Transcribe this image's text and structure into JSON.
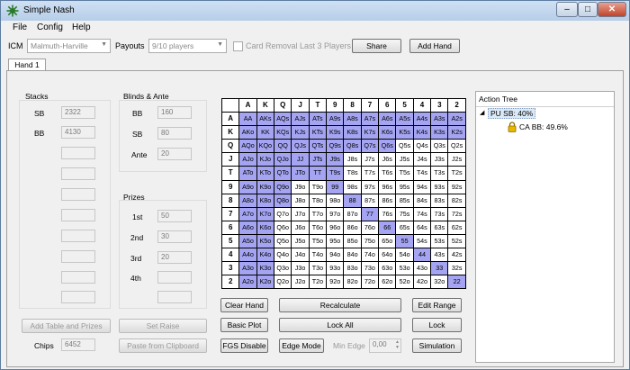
{
  "window": {
    "title": "Simple Nash"
  },
  "menu": [
    "File",
    "Config",
    "Help"
  ],
  "toolbar": {
    "icm_label": "ICM",
    "icm_value": "Malmuth-Harville",
    "payouts_label": "Payouts",
    "payouts_value": "9/10 players",
    "card_removal_label": "Card Removal Last 3 Players",
    "share_label": "Share",
    "add_hand_label": "Add Hand"
  },
  "tab": {
    "label": "Hand 1"
  },
  "stacks": {
    "title": "Stacks",
    "sb_label": "SB",
    "sb_value": "2322",
    "bb_label": "BB",
    "bb_value": "4130"
  },
  "blinds": {
    "title": "Blinds & Ante",
    "bb_label": "BB",
    "bb_value": "160",
    "sb_label": "SB",
    "sb_value": "80",
    "ante_label": "Ante",
    "ante_value": "20"
  },
  "prizes": {
    "title": "Prizes",
    "first_label": "1st",
    "first_value": "50",
    "second_label": "2nd",
    "second_value": "30",
    "third_label": "3rd",
    "third_value": "20",
    "fourth_label": "4th"
  },
  "bottom": {
    "add_table_label": "Add Table and Prizes",
    "set_raise_label": "Set Raise",
    "chips_label": "Chips",
    "chips_value": "6452",
    "paste_label": "Paste from Clipboard"
  },
  "grid": {
    "ranks": [
      "A",
      "K",
      "Q",
      "J",
      "T",
      "9",
      "8",
      "7",
      "6",
      "5",
      "4",
      "3",
      "2"
    ],
    "rows": [
      [
        "AA",
        "AKs",
        "AQs",
        "AJs",
        "ATs",
        "A9s",
        "A8s",
        "A7s",
        "A6s",
        "A5s",
        "A4s",
        "A3s",
        "A2s"
      ],
      [
        "AKo",
        "KK",
        "KQs",
        "KJs",
        "KTs",
        "K9s",
        "K8s",
        "K7s",
        "K6s",
        "K5s",
        "K4s",
        "K3s",
        "K2s"
      ],
      [
        "AQo",
        "KQo",
        "QQ",
        "QJs",
        "QTs",
        "Q9s",
        "Q8s",
        "Q7s",
        "Q6s",
        "Q5s",
        "Q4s",
        "Q3s",
        "Q2s"
      ],
      [
        "AJo",
        "KJo",
        "QJo",
        "JJ",
        "JTs",
        "J9s",
        "J8s",
        "J7s",
        "J6s",
        "J5s",
        "J4s",
        "J3s",
        "J2s"
      ],
      [
        "ATo",
        "KTo",
        "QTo",
        "JTo",
        "TT",
        "T9s",
        "T8s",
        "T7s",
        "T6s",
        "T5s",
        "T4s",
        "T3s",
        "T2s"
      ],
      [
        "A9o",
        "K9o",
        "Q9o",
        "J9o",
        "T9o",
        "99",
        "98s",
        "97s",
        "96s",
        "95s",
        "94s",
        "93s",
        "92s"
      ],
      [
        "A8o",
        "K8o",
        "Q8o",
        "J8o",
        "T8o",
        "98o",
        "88",
        "87s",
        "86s",
        "85s",
        "84s",
        "83s",
        "82s"
      ],
      [
        "A7o",
        "K7o",
        "Q7o",
        "J7o",
        "T7o",
        "97o",
        "87o",
        "77",
        "76s",
        "75s",
        "74s",
        "73s",
        "72s"
      ],
      [
        "A6o",
        "K6o",
        "Q6o",
        "J6o",
        "T6o",
        "96o",
        "86o",
        "76o",
        "66",
        "65s",
        "64s",
        "63s",
        "62s"
      ],
      [
        "A5o",
        "K5o",
        "Q5o",
        "J5o",
        "T5o",
        "95o",
        "85o",
        "75o",
        "65o",
        "55",
        "54s",
        "53s",
        "52s"
      ],
      [
        "A4o",
        "K4o",
        "Q4o",
        "J4o",
        "T4o",
        "94o",
        "84o",
        "74o",
        "64o",
        "54o",
        "44",
        "43s",
        "42s"
      ],
      [
        "A3o",
        "K3o",
        "Q3o",
        "J3o",
        "T3o",
        "93o",
        "83o",
        "73o",
        "63o",
        "53o",
        "43o",
        "33",
        "32s"
      ],
      [
        "A2o",
        "K2o",
        "Q2o",
        "J2o",
        "T2o",
        "92o",
        "82o",
        "72o",
        "62o",
        "52o",
        "42o",
        "32o",
        "22"
      ]
    ],
    "selected": [
      "AA",
      "AKs",
      "AQs",
      "AJs",
      "ATs",
      "A9s",
      "A8s",
      "A7s",
      "A6s",
      "A5s",
      "A4s",
      "A3s",
      "A2s",
      "AKo",
      "KK",
      "KQs",
      "KJs",
      "KTs",
      "K9s",
      "K8s",
      "K7s",
      "K6s",
      "K5s",
      "K4s",
      "K3s",
      "K2s",
      "AQo",
      "KQo",
      "QQ",
      "QJs",
      "QTs",
      "Q9s",
      "Q8s",
      "Q7s",
      "Q6s",
      "AJo",
      "KJo",
      "QJo",
      "JJ",
      "JTs",
      "J9s",
      "ATo",
      "KTo",
      "QTo",
      "JTo",
      "TT",
      "T9s",
      "A9o",
      "K9o",
      "Q9o",
      "99",
      "A8o",
      "K8o",
      "Q8o",
      "88",
      "A7o",
      "K7o",
      "77",
      "A6o",
      "K6o",
      "66",
      "A5o",
      "K5o",
      "55",
      "A4o",
      "K4o",
      "44",
      "A3o",
      "K3o",
      "33",
      "A2o",
      "K2o",
      "22"
    ],
    "selected_color": "#a4a4f2"
  },
  "buttons": {
    "clear_hand": "Clear Hand",
    "recalculate": "Recalculate",
    "edit_range": "Edit Range",
    "basic_plot": "Basic Plot",
    "lock_all": "Lock All",
    "lock": "Lock",
    "fgs_disable": "FGS Disable",
    "edge_mode": "Edge Mode",
    "min_edge_label": "Min Edge",
    "min_edge_value": "0,00",
    "simulation": "Simulation"
  },
  "action_tree": {
    "title": "Action Tree",
    "root": "PU SB: 40%",
    "child": "CA BB: 49.6%"
  }
}
